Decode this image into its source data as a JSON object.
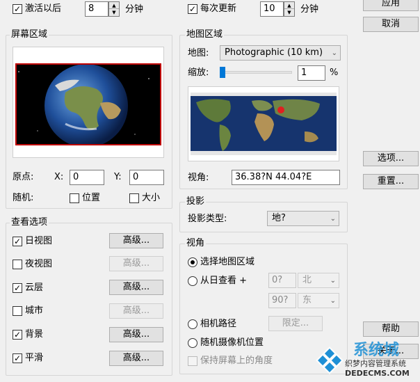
{
  "top": {
    "activate_label": "激活以后",
    "activate_value": "8",
    "activate_unit": "分钟",
    "update_label": "每次更新",
    "update_value": "10",
    "update_unit": "分钟"
  },
  "buttons": {
    "apply": "应用",
    "cancel": "取消",
    "options": "选项...",
    "reset": "重置...",
    "help": "帮助",
    "close": "关于..."
  },
  "screen_area": {
    "title": "屏幕区域",
    "origin_label": "原点:",
    "x_label": "X:",
    "x_value": "0",
    "y_label": "Y:",
    "y_value": "0",
    "random_label": "随机:",
    "position_label": "位置",
    "size_label": "大小"
  },
  "map_area": {
    "title": "地图区域",
    "map_label": "地图:",
    "map_value": "Photographic (10 km)",
    "zoom_label": "缩放:",
    "zoom_value": "1",
    "zoom_unit": "%",
    "zoom_level": 0.01,
    "view_label": "视角:",
    "view_value": "36.38?N   44.04?E"
  },
  "view_options": {
    "title": "查看选项",
    "advanced": "高级...",
    "items": [
      {
        "label": "日视图",
        "checked": true,
        "enabled": true
      },
      {
        "label": "夜视图",
        "checked": false,
        "enabled": false
      },
      {
        "label": "云层",
        "checked": true,
        "enabled": true
      },
      {
        "label": "城市",
        "checked": false,
        "enabled": false
      },
      {
        "label": "背景",
        "checked": true,
        "enabled": true
      },
      {
        "label": "平滑",
        "checked": true,
        "enabled": true
      }
    ]
  },
  "projection": {
    "title": "投影",
    "type_label": "投影类型:",
    "type_value": "地?"
  },
  "viewpoint": {
    "title": "视角",
    "select_region": "选择地图区域",
    "from_sun": "从日查看 +",
    "lat_value": "0?",
    "lat_dir": "北",
    "lon_value": "90?",
    "lon_dir": "东",
    "camera_path": "相机路径",
    "fixed_button": "限定...",
    "random_camera": "随机摄像机位置",
    "keep_angle": "保持屏幕上的角度"
  },
  "watermark": {
    "brand": "系统城",
    "line1": "织梦内容管理系统",
    "line2": "DEDECMS.COM"
  },
  "colors": {
    "accent": "#0078d7",
    "frame_red": "#c00000"
  }
}
